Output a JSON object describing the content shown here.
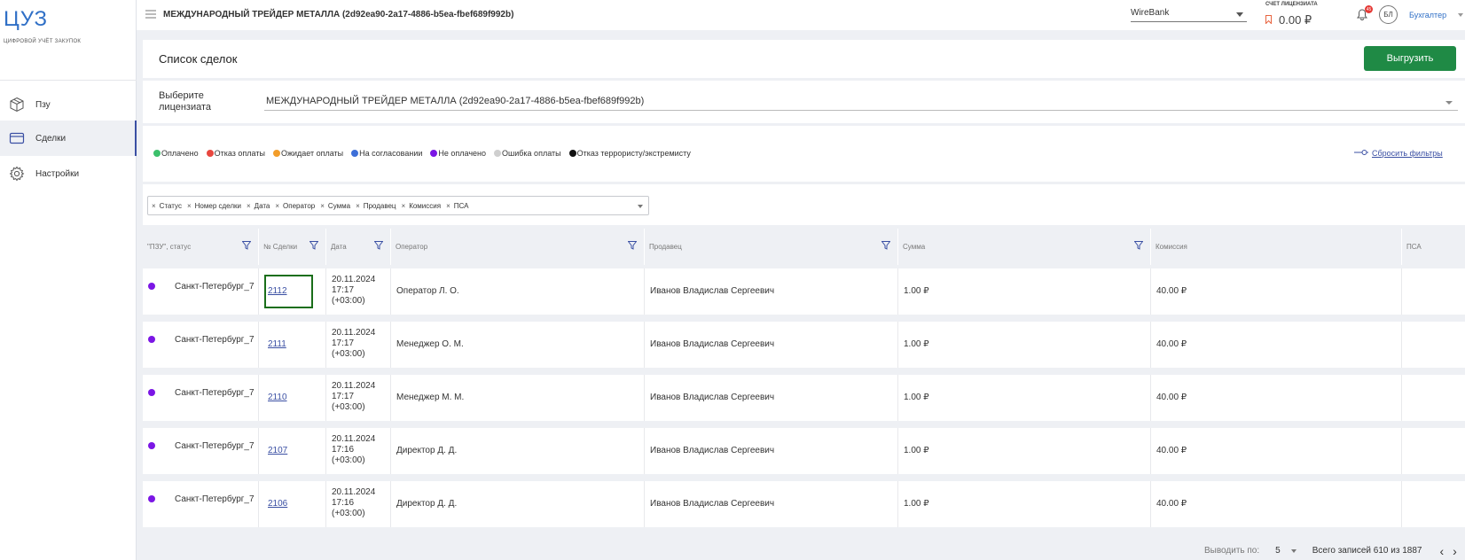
{
  "app": {
    "logo_title": "ЦУЗ",
    "logo_subtitle": "ЦИФРОВОЙ УЧЁТ ЗАКУПОК"
  },
  "sidebar": {
    "items": [
      {
        "label": "Пзу",
        "icon": "box-icon"
      },
      {
        "label": "Сделки",
        "icon": "card-icon",
        "active": true
      },
      {
        "label": "Настройки",
        "icon": "gear-icon"
      }
    ]
  },
  "topbar": {
    "company": "МЕЖДУНАРОДНЫЙ ТРЕЙДЕР МЕТАЛЛА (2d92ea90-2a17-4886-b5ea-fbef689f992b)",
    "bank": "WireBank",
    "account_label": "СЧЕТ ЛИЦЕНЗИАТА",
    "account_value": "0.00 ₽",
    "notifications": "45",
    "avatar_initials": "БЛ",
    "role": "Бухгалтер"
  },
  "page": {
    "title": "Список сделок",
    "export_label": "Выгрузить",
    "licensee_label": "Выберите лицензиата",
    "licensee_value": "МЕЖДУНАРОДНЫЙ ТРЕЙДЕР МЕТАЛЛА (2d92ea90-2a17-4886-b5ea-fbef689f992b)",
    "reset_filters": "Сбросить фильтры"
  },
  "legend": [
    {
      "label": "Оплачено",
      "color": "#3cc06b"
    },
    {
      "label": "Отказ оплаты",
      "color": "#e8473f"
    },
    {
      "label": "Ожидает оплаты",
      "color": "#f29d2a"
    },
    {
      "label": "На согласовании",
      "color": "#3d6fd8"
    },
    {
      "label": "Не оплачено",
      "color": "#7b16e5"
    },
    {
      "label": "Ошибка оплаты",
      "color": "#cfcfcf"
    },
    {
      "label": "Отказ террористу/экстремисту",
      "color": "#111111"
    }
  ],
  "column_chips": [
    "Статус",
    "Номер сделки",
    "Дата",
    "Оператор",
    "Сумма",
    "Продавец",
    "Комиссия",
    "ПСА"
  ],
  "table": {
    "headers": [
      "\"ПЗУ\", статус",
      "№ Сделки",
      "Дата",
      "Оператор",
      "Продавец",
      "Сумма",
      "Комиссия",
      "ПСА"
    ],
    "rows": [
      {
        "city": "Санкт-Петербург_7",
        "deal": "2112",
        "date1": "20.11.2024",
        "date2": "17:17",
        "date3": "(+03:00)",
        "operator": "Оператор Л. О.",
        "seller": "Иванов Владислав Сергеевич",
        "sum": "1.00 ₽",
        "commission": "40.00 ₽"
      },
      {
        "city": "Санкт-Петербург_7",
        "deal": "2111",
        "date1": "20.11.2024",
        "date2": "17:17",
        "date3": "(+03:00)",
        "operator": "Менеджер О. М.",
        "seller": "Иванов Владислав Сергеевич",
        "sum": "1.00 ₽",
        "commission": "40.00 ₽"
      },
      {
        "city": "Санкт-Петербург_7",
        "deal": "2110",
        "date1": "20.11.2024",
        "date2": "17:17",
        "date3": "(+03:00)",
        "operator": "Менеджер М. М.",
        "seller": "Иванов Владислав Сергеевич",
        "sum": "1.00 ₽",
        "commission": "40.00 ₽"
      },
      {
        "city": "Санкт-Петербург_7",
        "deal": "2107",
        "date1": "20.11.2024",
        "date2": "17:16",
        "date3": "(+03:00)",
        "operator": "Директор Д. Д.",
        "seller": "Иванов Владислав Сергеевич",
        "sum": "1.00 ₽",
        "commission": "40.00 ₽"
      },
      {
        "city": "Санкт-Петербург_7",
        "deal": "2106",
        "date1": "20.11.2024",
        "date2": "17:16",
        "date3": "(+03:00)",
        "operator": "Директор Д. Д.",
        "seller": "Иванов Владислав Сергеевич",
        "sum": "1.00 ₽",
        "commission": "40.00 ₽"
      }
    ]
  },
  "footer": {
    "per_page_label": "Выводить по:",
    "per_page_value": "5",
    "total": "Всего записей 610 из 1887"
  }
}
